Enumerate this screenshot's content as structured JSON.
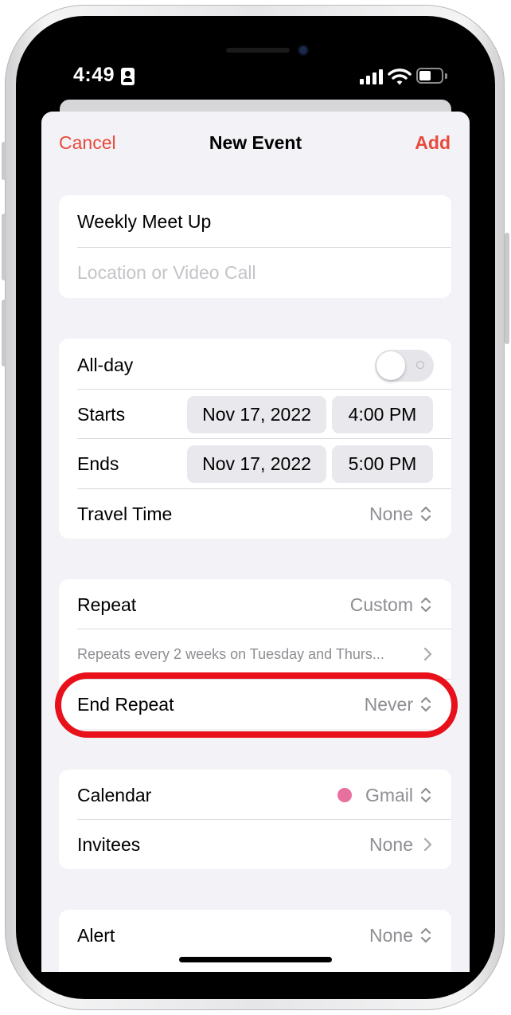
{
  "status_bar": {
    "time": "4:49"
  },
  "nav": {
    "cancel": "Cancel",
    "title": "New Event",
    "add": "Add"
  },
  "event": {
    "title": "Weekly Meet Up",
    "location_placeholder": "Location or Video Call"
  },
  "time_group": {
    "all_day_label": "All-day",
    "all_day_on": false,
    "starts_label": "Starts",
    "starts_date": "Nov 17, 2022",
    "starts_time": "4:00 PM",
    "ends_label": "Ends",
    "ends_date": "Nov 17, 2022",
    "ends_time": "5:00 PM",
    "travel_label": "Travel Time",
    "travel_value": "None"
  },
  "repeat_group": {
    "repeat_label": "Repeat",
    "repeat_value": "Custom",
    "repeat_summary": "Repeats every 2 weeks on Tuesday and Thurs...",
    "end_repeat_label": "End Repeat",
    "end_repeat_value": "Never"
  },
  "calendar_group": {
    "calendar_label": "Calendar",
    "calendar_value": "Gmail",
    "calendar_color": "#e8709e",
    "invitees_label": "Invitees",
    "invitees_value": "None"
  },
  "alert_group": {
    "alert_label": "Alert",
    "alert_value": "None"
  },
  "colors": {
    "accent": "#e84a3c",
    "highlight": "#e8111b",
    "secondary_text": "#8e8e93"
  }
}
